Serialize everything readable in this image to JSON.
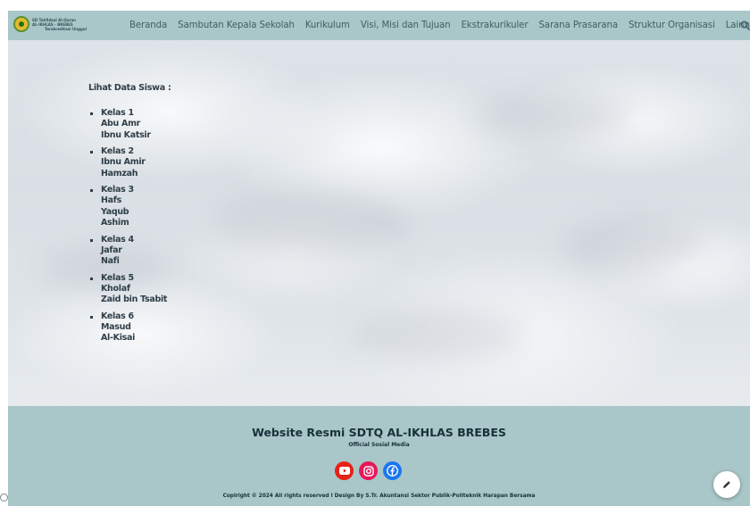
{
  "header": {
    "logo": {
      "line1": "SD Tahfidzul Al-Quran",
      "line2": "AL-IKHLAS - BREBES",
      "line3": "Terakreditasi Unggul"
    },
    "nav": [
      "Beranda",
      "Sambutan Kepala Sekolah",
      "Kurikulum",
      "Visi, Misi dan Tujuan",
      "Ekstrakurikuler",
      "Sarana Prasarana",
      "Struktur Organisasi"
    ],
    "more_label": "Lainnya",
    "icons": {
      "more": "chevron-down-icon",
      "search": "search-icon"
    }
  },
  "main": {
    "heading": "Lihat Data Siswa :",
    "classes": [
      {
        "name": "Kelas 1",
        "students": [
          "Abu Amr",
          "Ibnu Katsir"
        ]
      },
      {
        "name": "Kelas 2",
        "students": [
          "Ibnu Amir",
          "Hamzah"
        ]
      },
      {
        "name": "Kelas 3",
        "students": [
          "Hafs",
          "Yaqub",
          "Ashim"
        ]
      },
      {
        "name": "Kelas 4",
        "students": [
          "Jafar",
          "Nafi"
        ]
      },
      {
        "name": "Kelas 5",
        "students": [
          "Kholaf",
          "Zaid  bin Tsabit"
        ]
      },
      {
        "name": "Kelas 6",
        "students": [
          "Masud",
          "Al-Kisai"
        ]
      }
    ]
  },
  "footer": {
    "title": "Website Resmi SDTQ AL-IKHLAS BREBES",
    "subtitle": "Official Sosial Media",
    "socials": [
      {
        "name": "youtube",
        "icon": "youtube-icon",
        "color": "#e62117"
      },
      {
        "name": "instagram",
        "icon": "instagram-icon",
        "color": "#e8175a"
      },
      {
        "name": "facebook",
        "icon": "facebook-icon",
        "color": "#1877f2"
      }
    ],
    "copyright": "Copiright © 2024  All rights reserved l Design By S.Tr. Akuntansi Sektor Publik-Politeknik Harapan Bersama"
  },
  "colors": {
    "header_bg": "#a9c6c8",
    "footer_bg": "#a9c6c8",
    "nav_text": "#3f5f66",
    "body_text": "#2f3e48"
  },
  "fab": {
    "icon": "pencil-icon"
  }
}
